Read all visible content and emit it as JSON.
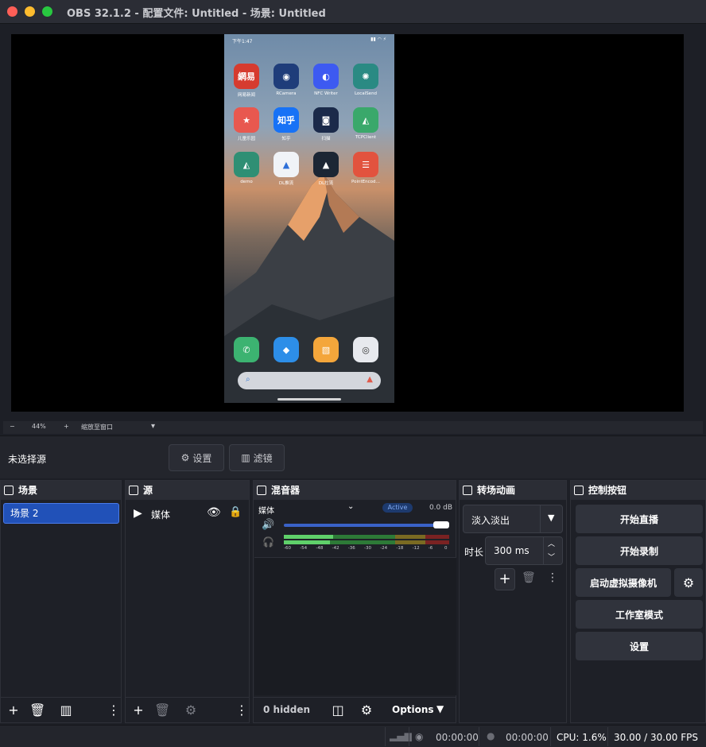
{
  "window": {
    "title": "OBS 32.1.2 - 配置文件: Untitled - 场景: Untitled"
  },
  "phone": {
    "status_time": "下午1:47",
    "apps": [
      {
        "label": "网易新闻",
        "glyph": "網易",
        "color": "#d63b2f"
      },
      {
        "label": "RCamera",
        "glyph": "◉",
        "color": "#1f3d7a"
      },
      {
        "label": "NFC Writer",
        "glyph": "◐",
        "color": "#3d5af1"
      },
      {
        "label": "LocalSend",
        "glyph": "✺",
        "color": "#2a8a83"
      },
      {
        "label": "儿童乐园",
        "glyph": "★",
        "color": "#e8584f"
      },
      {
        "label": "知乎",
        "glyph": "知乎",
        "color": "#1772f6"
      },
      {
        "label": "扫描",
        "glyph": "◙",
        "color": "#1b2a4a"
      },
      {
        "label": "TCPClient",
        "glyph": "◭",
        "color": "#3aa86b"
      },
      {
        "label": "demo",
        "glyph": "◭",
        "color": "#2f8f74"
      },
      {
        "label": "DL推流",
        "glyph": "▲",
        "color": "#f0f3f7"
      },
      {
        "label": "DL拉流",
        "glyph": "▲",
        "color": "#1c2634"
      },
      {
        "label": "PointEncod…",
        "glyph": "☰",
        "color": "#e2533e"
      }
    ],
    "dock_apps": [
      {
        "name": "phone",
        "glyph": "✆",
        "color": "#3cb371"
      },
      {
        "name": "messages",
        "glyph": "◆",
        "color": "#2d8ee8"
      },
      {
        "name": "notes",
        "glyph": "▧",
        "color": "#f4a63b"
      },
      {
        "name": "camera",
        "glyph": "◎",
        "color": "#e7e9ee"
      }
    ]
  },
  "zoom": {
    "minus": "−",
    "value": "44%",
    "plus": "+",
    "fit": "缩放至窗口",
    "caret": "▾"
  },
  "source_bar": {
    "no_source": "未选择源",
    "settings": "设置",
    "filters": "滤镜"
  },
  "scenes": {
    "title": "场景",
    "items": [
      "场景 2"
    ]
  },
  "sources": {
    "title": "源",
    "items": [
      {
        "name": "媒体"
      }
    ]
  },
  "mixer": {
    "title": "混音器",
    "channel": "媒体",
    "status": "Active",
    "db": "0.0 dB",
    "ticks": [
      "-60",
      "-54",
      "-48",
      "-42",
      "-36",
      "-30",
      "-24",
      "-18",
      "-12",
      "-6",
      "0"
    ],
    "hidden": "0 hidden",
    "options": "Options"
  },
  "transitions": {
    "title": "转场动画",
    "selected": "淡入淡出",
    "duration_label": "时长",
    "duration": "300 ms"
  },
  "controls": {
    "title": "控制按钮",
    "start_stream": "开始直播",
    "start_record": "开始录制",
    "virtual_cam": "启动虚拟摄像机",
    "studio_mode": "工作室模式",
    "settings": "设置"
  },
  "status": {
    "stream_time": "00:00:00",
    "record_time": "00:00:00",
    "cpu": "CPU: 1.6%",
    "fps": "30.00 / 30.00 FPS"
  }
}
